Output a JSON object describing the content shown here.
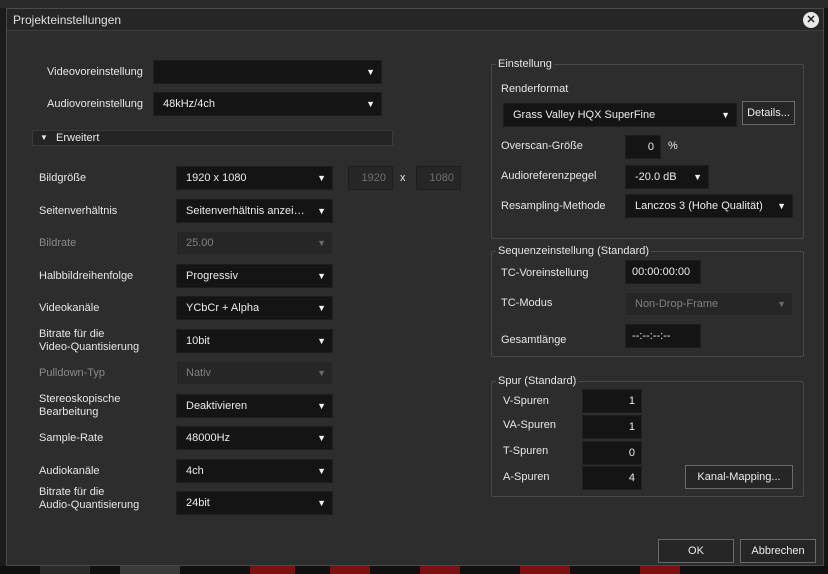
{
  "dialog": {
    "title": "Projekteinstellungen",
    "close_symbol": "✕"
  },
  "presets": {
    "video_label": "Videovoreinstellung",
    "video_value": "",
    "audio_label": "Audiovoreinstellung",
    "audio_value": "48kHz/4ch"
  },
  "advanced": {
    "label": "Erweitert"
  },
  "settings": {
    "frame_size": {
      "label": "Bildgröße",
      "value": "1920 x 1080",
      "width": "1920",
      "x": "x",
      "height": "1080"
    },
    "aspect_ratio": {
      "label": "Seitenverhältnis",
      "value": "Seitenverhältnis anzeigen"
    },
    "frame_rate": {
      "label": "Bildrate",
      "value": "25.00"
    },
    "field_order": {
      "label": "Halbbildreihenfolge",
      "value": "Progressiv"
    },
    "video_channels": {
      "label": "Videokanäle",
      "value": "YCbCr + Alpha"
    },
    "video_bitrate": {
      "label_line1": "Bitrate für die",
      "label_line2": "Video-Quantisierung",
      "value": "10bit"
    },
    "pulldown": {
      "label": "Pulldown-Typ",
      "value": "Nativ"
    },
    "stereo": {
      "label_line1": "Stereoskopische",
      "label_line2": "Bearbeitung",
      "value": "Deaktivieren"
    },
    "sample_rate": {
      "label": "Sample-Rate",
      "value": "48000Hz"
    },
    "audio_channels": {
      "label": "Audiokanäle",
      "value": "4ch"
    },
    "audio_bitrate": {
      "label_line1": "Bitrate für die",
      "label_line2": "Audio-Quantisierung",
      "value": "24bit"
    }
  },
  "einstellung": {
    "title": "Einstellung",
    "render_format_label": "Renderformat",
    "render_format_value": "Grass Valley HQX SuperFine",
    "details_button": "Details...",
    "overscan_label": "Overscan-Größe",
    "overscan_value": "0",
    "overscan_unit": "%",
    "audio_ref_label": "Audioreferenzpegel",
    "audio_ref_value": "-20.0 dB",
    "resampling_label": "Resampling-Methode",
    "resampling_value": "Lanczos 3 (Hohe Qualität)"
  },
  "sequence": {
    "title": "Sequenzeinstellung (Standard)",
    "tc_preset_label": "TC-Voreinstellung",
    "tc_preset_value": "00:00:00:00",
    "tc_mode_label": "TC-Modus",
    "tc_mode_value": "Non-Drop-Frame",
    "total_length_label": "Gesamtlänge",
    "total_length_value": "--:--:--:--"
  },
  "tracks": {
    "title": "Spur (Standard)",
    "v_label": "V-Spuren",
    "v_value": "1",
    "va_label": "VA-Spuren",
    "va_value": "1",
    "t_label": "T-Spuren",
    "t_value": "0",
    "a_label": "A-Spuren",
    "a_value": "4",
    "channel_mapping_button": "Kanal-Mapping..."
  },
  "buttons": {
    "ok": "OK",
    "cancel": "Abbrechen"
  },
  "icons": {
    "dropdown_arrow": "▼",
    "section_toggle": "▼"
  },
  "colors": {
    "dialog_bg": "#2d2d2d",
    "field_bg": "#141414",
    "text": "#e6e6e6",
    "disabled_text": "#8a8a8a",
    "group_border": "#4a4a4a"
  }
}
